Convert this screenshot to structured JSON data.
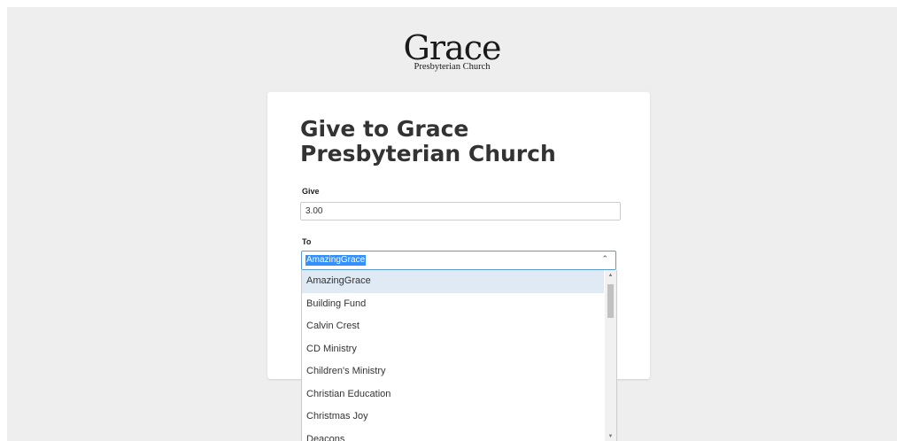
{
  "logo": {
    "title": "Grace",
    "subtitle": "Presbyterian Church"
  },
  "form": {
    "heading": "Give to Grace Presbyterian Church",
    "give_label": "Give",
    "give_value": "3.00",
    "to_label": "To",
    "selected_fund": "AmazingGrace"
  },
  "dropdown": {
    "options": [
      "AmazingGrace",
      "Building Fund",
      "Calvin Crest",
      "CD Ministry",
      "Children's Ministry",
      "Christian Education",
      "Christmas Joy",
      "Deacons"
    ],
    "highlighted_index": 0
  },
  "colors": {
    "page_background": "#eeeeee",
    "focus_border": "#5b9bd5",
    "selection_highlight": "#3390ff",
    "option_highlight": "#dfeaf4"
  },
  "icons": {
    "select_toggle": "chevron-up-icon",
    "scroll_up": "scroll-up-arrow-icon",
    "scroll_down": "scroll-down-arrow-icon"
  }
}
